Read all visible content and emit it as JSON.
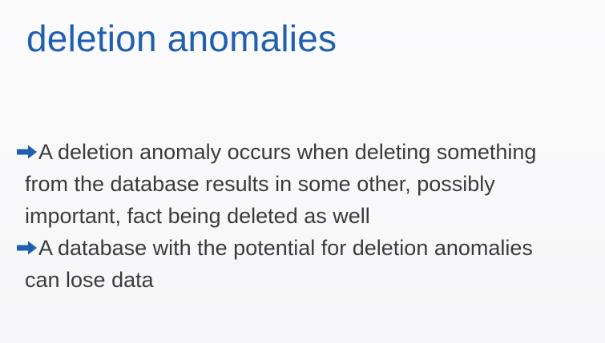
{
  "slide": {
    "title": "deletion anomalies",
    "accent_color": "#1f5fb0",
    "bullet_icon": "right-arrow-icon",
    "bullets": [
      {
        "lines": [
          "A deletion anomaly occurs when deleting something",
          "from the database results in some other, possibly",
          "important, fact being deleted as well"
        ]
      },
      {
        "lines": [
          "A database with the potential for deletion anomalies",
          "can lose data"
        ]
      }
    ]
  }
}
